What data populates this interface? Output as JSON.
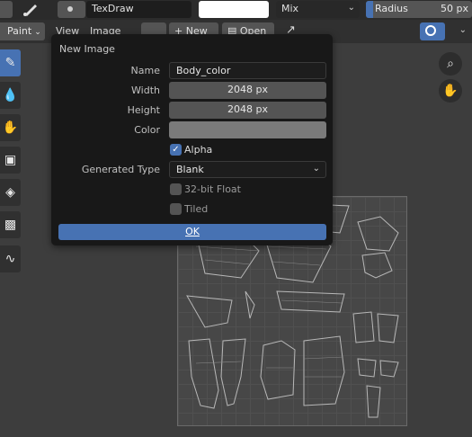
{
  "header": {
    "brush_name": "TexDraw",
    "blend_mode": "Mix",
    "radius_label": "Radius",
    "radius_value": "50 px",
    "brush_color": "#ffffff"
  },
  "subheader": {
    "mode": "Paint",
    "menus": [
      "View",
      "Image"
    ],
    "new_label": "New",
    "open_label": "Open"
  },
  "dialog": {
    "title": "New Image",
    "name_label": "Name",
    "name_value": "Body_color",
    "width_label": "Width",
    "width_value": "2048 px",
    "height_label": "Height",
    "height_value": "2048 px",
    "color_label": "Color",
    "color_value": "#7a7a7a",
    "alpha_label": "Alpha",
    "alpha_checked": true,
    "generated_type_label": "Generated Type",
    "generated_type_value": "Blank",
    "float_label": "32-bit Float",
    "float_checked": false,
    "tiled_label": "Tiled",
    "tiled_checked": false,
    "ok_label": "OK"
  },
  "colors": {
    "accent": "#4772b3",
    "panel": "#181818",
    "background": "#3d3d3d"
  },
  "icons": {
    "toolbar": [
      "draw-brush-icon",
      "soften-icon",
      "smear-icon",
      "clone-icon",
      "fill-icon",
      "mask-icon",
      "annotate-icon"
    ],
    "navigation": [
      "zoom-icon",
      "pan-hand-icon"
    ]
  }
}
